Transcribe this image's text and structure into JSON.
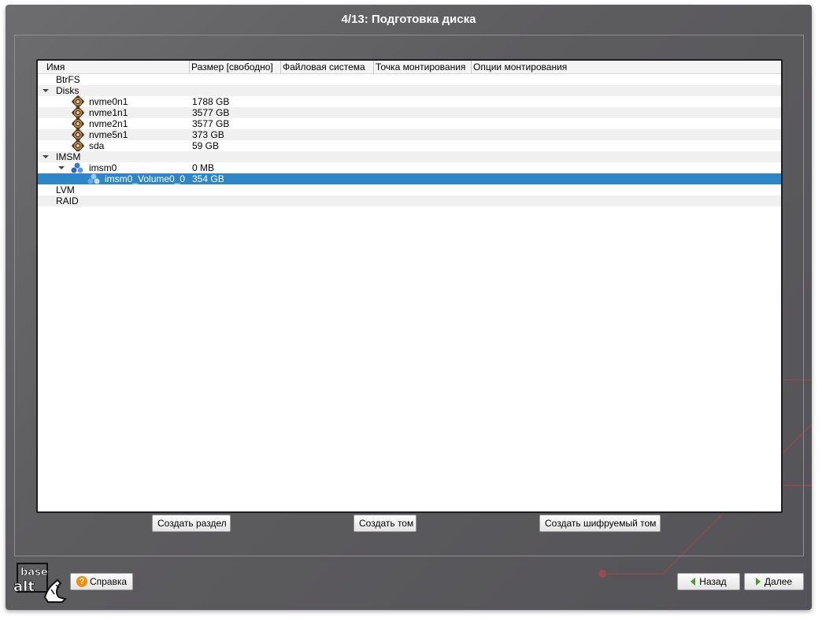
{
  "window": {
    "title": "4/13: Подготовка диска"
  },
  "tree": {
    "columns": [
      "Имя",
      "Размер [свободно]",
      "Файловая система",
      "Точка монтирования",
      "Опции монтирования"
    ],
    "rows": [
      {
        "name": "BtrFS",
        "size": ""
      },
      {
        "name": "Disks",
        "size": ""
      },
      {
        "name": "nvme0n1",
        "size": "1788 GB",
        "icon": "disk-icon"
      },
      {
        "name": "nvme1n1",
        "size": "3577 GB",
        "icon": "disk-icon"
      },
      {
        "name": "nvme2n1",
        "size": "3577 GB",
        "icon": "disk-icon"
      },
      {
        "name": "nvme5n1",
        "size": "373 GB",
        "icon": "disk-icon"
      },
      {
        "name": "sda",
        "size": "59 GB",
        "icon": "disk-icon"
      },
      {
        "name": "IMSM",
        "size": ""
      },
      {
        "name": "imsm0",
        "size": "0 MB",
        "icon": "raid-icon"
      },
      {
        "name": "imsm0_Volume0_0",
        "size": "354 GB",
        "icon": "raid-icon",
        "selected": true
      },
      {
        "name": "LVM",
        "size": ""
      },
      {
        "name": "RAID",
        "size": ""
      }
    ]
  },
  "actions": {
    "create_partition": "Создать раздел",
    "create_volume": "Создать том",
    "create_encrypted_volume": "Создать шифруемый том"
  },
  "footer": {
    "help": "Справка",
    "back": "Назад",
    "next": "Далее",
    "logo_text_top": "base",
    "logo_text_bottom": "alt"
  },
  "colors": {
    "window_bg": "#5f5e62",
    "selection": "#2f86c6",
    "accent_line": "#a8454a"
  }
}
